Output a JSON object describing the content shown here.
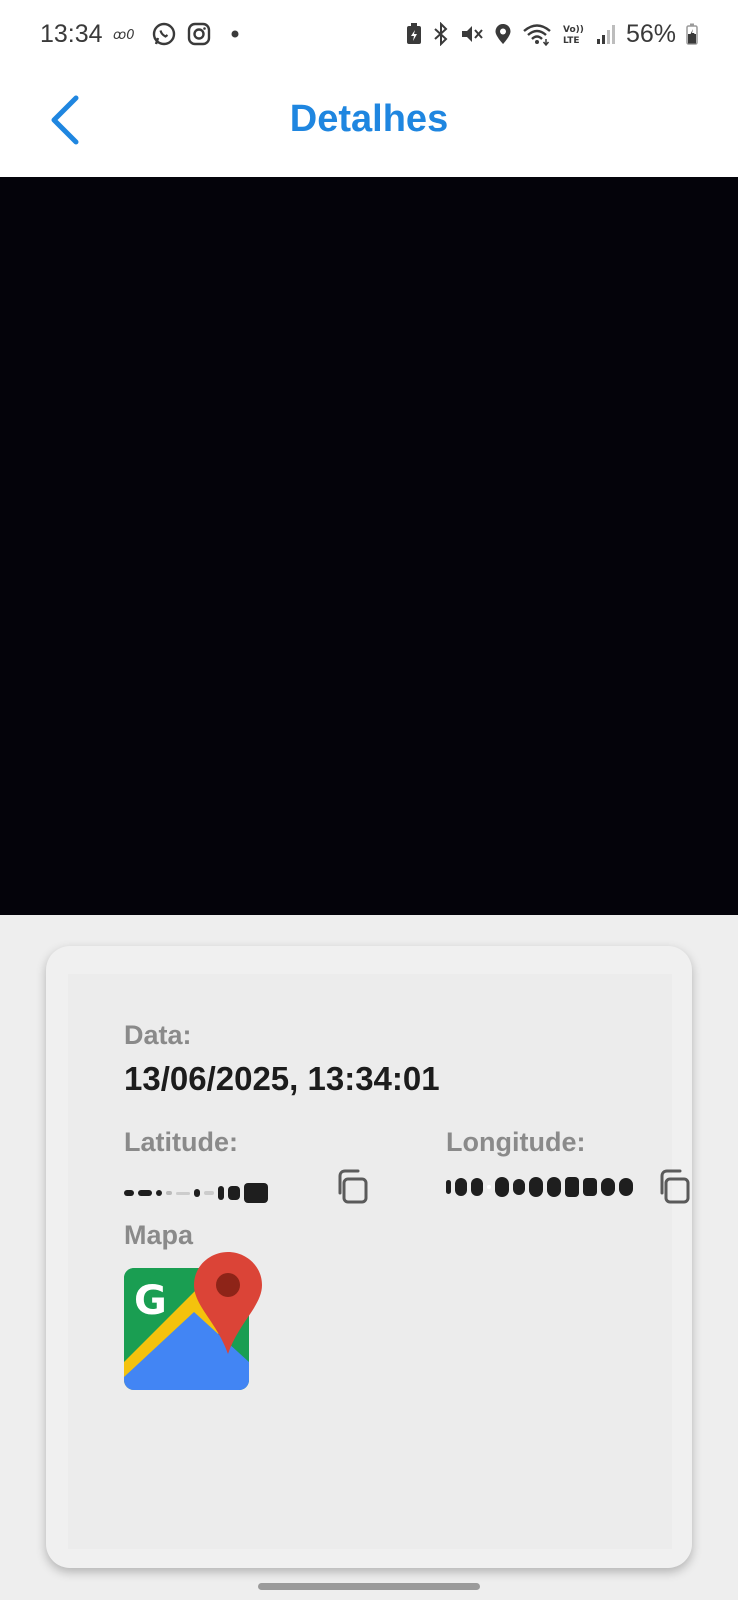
{
  "status_bar": {
    "time": "13:34",
    "battery_percent": "56%",
    "icons_left": [
      "voicemail-icon",
      "whatsapp-icon",
      "instagram-icon",
      "notification-dot-icon"
    ],
    "icons_right": [
      "battery-saver-icon",
      "bluetooth-icon",
      "mute-icon",
      "location-icon",
      "wifi-icon",
      "volte-icon",
      "signal-icon",
      "battery-icon"
    ]
  },
  "header": {
    "title": "Detalhes",
    "back_icon": "chevron-left-icon"
  },
  "details": {
    "date_label": "Data:",
    "date_value": "13/06/2025, 13:34:01",
    "latitude_label": "Latitude:",
    "longitude_label": "Longitude:",
    "map_label": "Mapa",
    "copy_icon": "copy-icon",
    "map_icon": "google-maps-icon"
  },
  "colors": {
    "accent": "#1f86e0",
    "label_gray": "#8a8a8a",
    "photo_bg": "#04030a",
    "card_bg": "#f0f0f0"
  }
}
